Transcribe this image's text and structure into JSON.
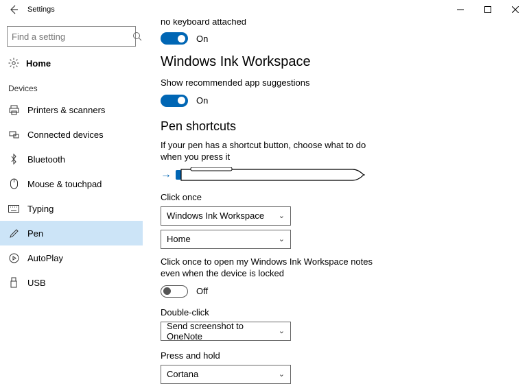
{
  "titlebar": {
    "title": "Settings"
  },
  "search": {
    "placeholder": "Find a setting"
  },
  "home": {
    "label": "Home"
  },
  "nav_header": "Devices",
  "nav": [
    {
      "label": "Printers & scanners"
    },
    {
      "label": "Connected devices"
    },
    {
      "label": "Bluetooth"
    },
    {
      "label": "Mouse & touchpad"
    },
    {
      "label": "Typing"
    },
    {
      "label": "Pen"
    },
    {
      "label": "AutoPlay"
    },
    {
      "label": "USB"
    }
  ],
  "main": {
    "truncated_line": "no keyboard attached",
    "toggle1": {
      "state": "On"
    },
    "section1_title": "Windows Ink Workspace",
    "section1_desc": "Show recommended app suggestions",
    "toggle2": {
      "state": "On"
    },
    "section2_title": "Pen shortcuts",
    "section2_desc": "If your pen has a shortcut button, choose what to do when you press it",
    "click_once_label": "Click once",
    "click_once_sel1": "Windows Ink Workspace",
    "click_once_sel2": "Home",
    "locked_desc": "Click once to open my Windows Ink Workspace notes even when the device is locked",
    "toggle3": {
      "state": "Off"
    },
    "double_click_label": "Double-click",
    "double_click_sel": "Send screenshot to OneNote",
    "press_hold_label": "Press and hold",
    "press_hold_sel": "Cortana"
  }
}
